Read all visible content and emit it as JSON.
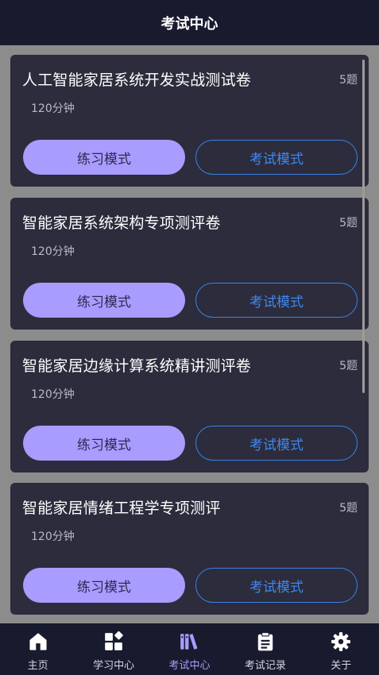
{
  "header": {
    "title": "考试中心"
  },
  "cards": [
    {
      "title": "人工智能家居系统开发实战测试卷",
      "count": "5题",
      "duration": "120分钟",
      "practice_label": "练习模式",
      "exam_label": "考试模式"
    },
    {
      "title": "智能家居系统架构专项测评卷",
      "count": "5题",
      "duration": "120分钟",
      "practice_label": "练习模式",
      "exam_label": "考试模式"
    },
    {
      "title": "智能家居边缘计算系统精讲测评卷",
      "count": "5题",
      "duration": "120分钟",
      "practice_label": "练习模式",
      "exam_label": "考试模式"
    },
    {
      "title": "智能家居情绪工程学专项测评",
      "count": "5题",
      "duration": "120分钟",
      "practice_label": "练习模式",
      "exam_label": "考试模式"
    }
  ],
  "tabbar": {
    "items": [
      {
        "label": "主页",
        "icon": "home-icon"
      },
      {
        "label": "学习中心",
        "icon": "grid-icon"
      },
      {
        "label": "考试中心",
        "icon": "books-icon",
        "active": true
      },
      {
        "label": "考试记录",
        "icon": "clipboard-icon"
      },
      {
        "label": "关于",
        "icon": "gear-icon"
      }
    ]
  },
  "colors": {
    "accent": "#a99cff",
    "exam_border": "#3b82e6",
    "card_bg": "#2c2c3d",
    "bar_bg": "#181a2e"
  }
}
